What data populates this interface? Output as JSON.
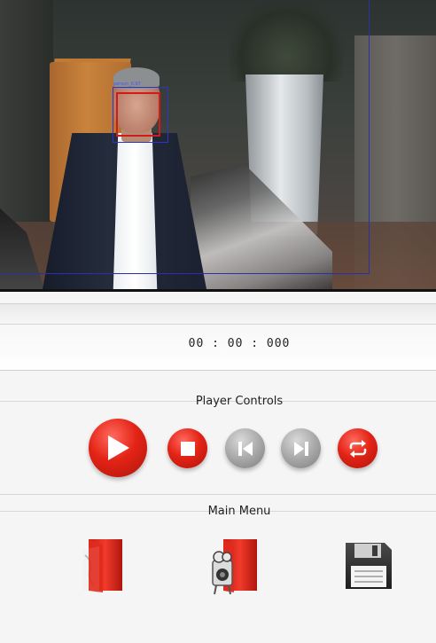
{
  "video": {
    "face_label": "person_0.97",
    "roi_color": "#2b2fa8",
    "face_box_color": "#d21a1a"
  },
  "timer": {
    "time": "00 : 00 : 000"
  },
  "player_controls": {
    "title": "Player Controls",
    "buttons": [
      {
        "name": "play",
        "icon": "play-icon",
        "color": "red"
      },
      {
        "name": "stop",
        "icon": "stop-icon",
        "color": "red"
      },
      {
        "name": "previous",
        "icon": "skip-back-icon",
        "color": "grey"
      },
      {
        "name": "next",
        "icon": "skip-forward-icon",
        "color": "grey"
      },
      {
        "name": "loop",
        "icon": "loop-icon",
        "color": "red"
      }
    ]
  },
  "main_menu": {
    "title": "Main Menu",
    "items": [
      {
        "name": "open-media",
        "icon": "open-folder-icon"
      },
      {
        "name": "open-camera",
        "icon": "camera-folder-icon"
      },
      {
        "name": "save",
        "icon": "floppy-disk-icon"
      }
    ]
  },
  "colors": {
    "accent_red": "#e32416",
    "disabled_grey": "#a9a9a9"
  }
}
